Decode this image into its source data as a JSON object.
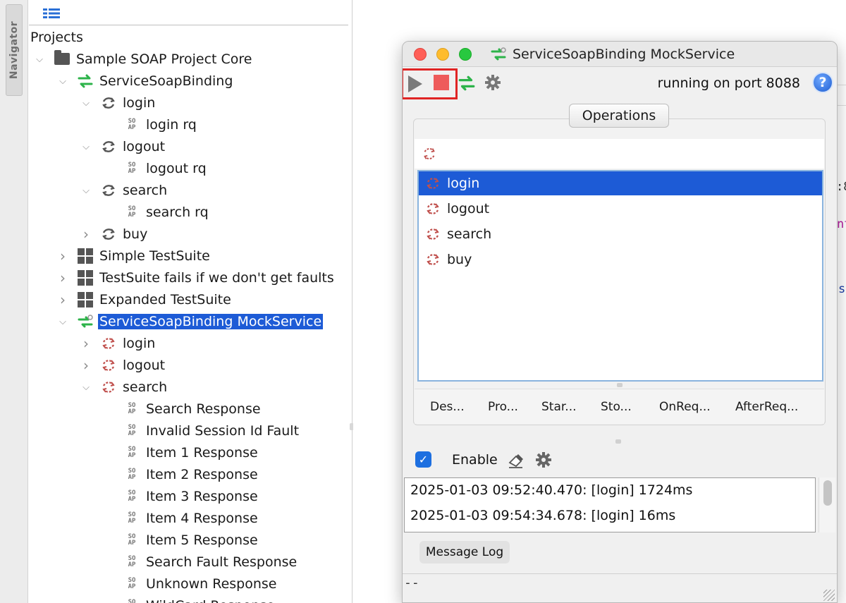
{
  "navigator": {
    "tab_label": "Navigator"
  },
  "tree": {
    "root_label": "Projects",
    "items": [
      {
        "label": "Sample SOAP Project Core",
        "icon": "folder-icon",
        "chevron": "down"
      },
      {
        "label": "ServiceSoapBinding",
        "icon": "interface-icon",
        "chevron": "down"
      },
      {
        "label": "login",
        "icon": "operation-icon",
        "chevron": "down"
      },
      {
        "label": "login rq",
        "icon": "soap-request-icon",
        "chevron": ""
      },
      {
        "label": "logout",
        "icon": "operation-icon",
        "chevron": "down"
      },
      {
        "label": "logout rq",
        "icon": "soap-request-icon",
        "chevron": ""
      },
      {
        "label": "search",
        "icon": "operation-icon",
        "chevron": "down"
      },
      {
        "label": "search rq",
        "icon": "soap-request-icon",
        "chevron": ""
      },
      {
        "label": "buy",
        "icon": "operation-icon",
        "chevron": "right"
      },
      {
        "label": "Simple TestSuite",
        "icon": "testsuite-icon",
        "chevron": "right"
      },
      {
        "label": "TestSuite fails if we don't get faults",
        "icon": "testsuite-icon",
        "chevron": "right"
      },
      {
        "label": "Expanded TestSuite",
        "icon": "testsuite-icon",
        "chevron": "right"
      },
      {
        "label": "ServiceSoapBinding MockService",
        "icon": "mockservice-icon",
        "chevron": "down",
        "selected": true
      },
      {
        "label": "login",
        "icon": "mock-operation-icon",
        "chevron": "right"
      },
      {
        "label": "logout",
        "icon": "mock-operation-icon",
        "chevron": "right"
      },
      {
        "label": "search",
        "icon": "mock-operation-icon",
        "chevron": "down"
      },
      {
        "label": "Search Response",
        "icon": "mock-response-icon",
        "chevron": ""
      },
      {
        "label": "Invalid Session Id Fault",
        "icon": "mock-response-icon",
        "chevron": ""
      },
      {
        "label": "Item 1 Response",
        "icon": "mock-response-icon",
        "chevron": ""
      },
      {
        "label": "Item 2 Response",
        "icon": "mock-response-icon",
        "chevron": ""
      },
      {
        "label": "Item 3 Response",
        "icon": "mock-response-icon",
        "chevron": ""
      },
      {
        "label": "Item 4 Response",
        "icon": "mock-response-icon",
        "chevron": ""
      },
      {
        "label": "Item 5 Response",
        "icon": "mock-response-icon",
        "chevron": ""
      },
      {
        "label": "Search Fault Response",
        "icon": "mock-response-icon",
        "chevron": ""
      },
      {
        "label": "Unknown Response",
        "icon": "mock-response-icon",
        "chevron": ""
      },
      {
        "label": "WildCard Response",
        "icon": "mock-response-icon",
        "chevron": ""
      }
    ]
  },
  "background": {
    "edge_chars": [
      ":8",
      "nt",
      "s"
    ]
  },
  "mock_window": {
    "title": "ServiceSoapBinding MockService",
    "status": "running on port 8088",
    "help_label": "?",
    "operations_tab": "Operations",
    "operations": [
      "login",
      "logout",
      "search",
      "buy"
    ],
    "selected_operation": 0,
    "subtabs": [
      "Des...",
      "Pro...",
      "Star...",
      "Sto...",
      "OnReq...",
      "AfterReq..."
    ],
    "enable_label": "Enable",
    "enable_checked": true,
    "log": [
      "2025-01-03 09:52:40.470: [login] 1724ms",
      "2025-01-03 09:54:34.678: [login] 16ms"
    ],
    "message_log_button": "Message Log",
    "status_bar": "--"
  },
  "colors": {
    "selection": "#1d5bd6",
    "interface_green": "#2db34a",
    "mock_red": "#c0504d",
    "stop_red": "#ee5b5b",
    "highlight_red": "#e02424"
  }
}
